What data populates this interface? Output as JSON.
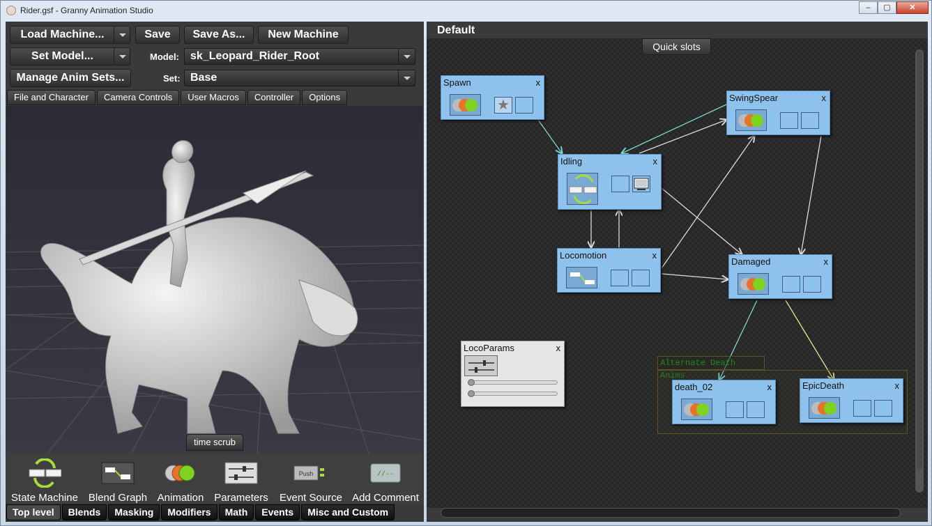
{
  "window": {
    "title": "Rider.gsf - Granny Animation Studio",
    "min": "–",
    "max": "▢",
    "close": "✕"
  },
  "toolbar": {
    "load_machine": "Load Machine...",
    "save": "Save",
    "save_as": "Save As...",
    "new_machine": "New Machine",
    "set_model": "Set Model...",
    "manage_anim_sets": "Manage Anim Sets...",
    "model_label": "Model:",
    "model_value": "sk_Leopard_Rider_Root",
    "set_label": "Set:",
    "set_value": "Base"
  },
  "top_tabs": [
    "File and Character",
    "Camera Controls",
    "User Macros",
    "Controller",
    "Options"
  ],
  "time_scrub": "time scrub",
  "tools": [
    "State Machine",
    "Blend Graph",
    "Animation",
    "Parameters",
    "Event Source",
    "Add Comment"
  ],
  "event_source_icon_text": "Push",
  "comment_icon_text": "//--",
  "bottom_tabs": [
    "Top level",
    "Blends",
    "Masking",
    "Modifiers",
    "Math",
    "Events",
    "Misc and Custom"
  ],
  "graph": {
    "title": "Default",
    "quick_slots": "Quick slots",
    "group_label": "Alternate Death Anims",
    "close_glyph": "x",
    "nodes": {
      "spawn": "Spawn",
      "swingspear": "SwingSpear",
      "idling": "Idling",
      "locomotion": "Locomotion",
      "damaged": "Damaged",
      "locoparams": "LocoParams",
      "death_02": "death_02",
      "epicdeath": "EpicDeath"
    }
  },
  "colors": {
    "accent": "#8ec2ec",
    "panel": "#3a3a3a",
    "link_cyan": "#7fd8d0",
    "link_yellow": "#e6e69a",
    "group_text": "#1e8a1e"
  }
}
